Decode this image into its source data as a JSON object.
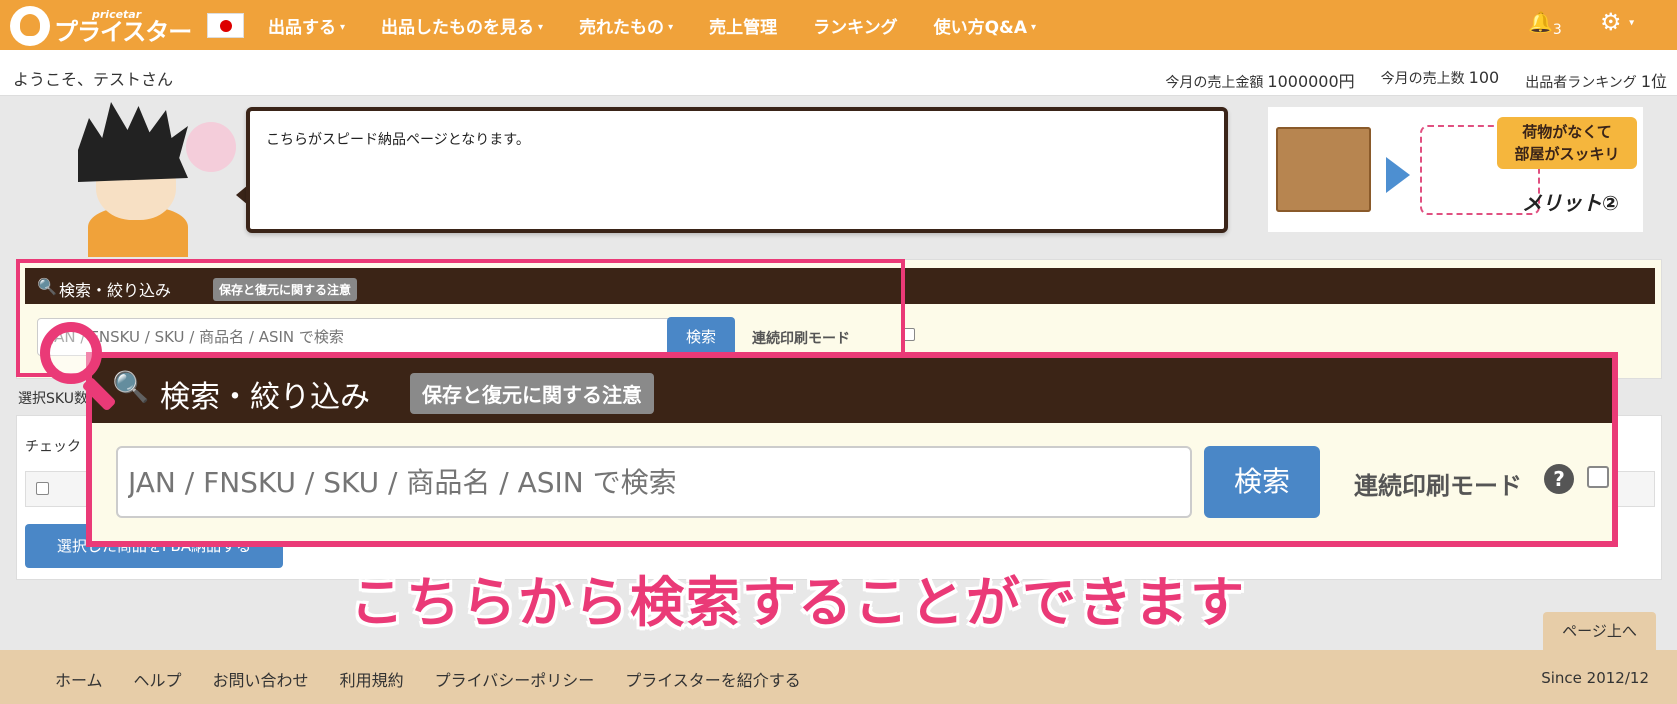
{
  "nav": {
    "logo_small": "pricetar",
    "logo_big": "プライスター",
    "items": [
      {
        "label": "出品する",
        "caret": "▾"
      },
      {
        "label": "出品したものを見る",
        "caret": "▾"
      },
      {
        "label": "売れたもの",
        "caret": "▾"
      },
      {
        "label": "売上管理",
        "caret": ""
      },
      {
        "label": "ランキング",
        "caret": ""
      },
      {
        "label": "使い方Q&A",
        "caret": "▾"
      }
    ],
    "bell_icon": "🔔",
    "bell_count": "3",
    "gear_icon": "⚙",
    "gear_caret": "▾"
  },
  "welcome": {
    "greeting": "ようこそ、テストさん",
    "sales_amount_label": "今月の売上金額",
    "sales_amount": "1000000円",
    "sales_count_label": "今月の売上数",
    "sales_count": "100",
    "ranking_label": "出品者ランキング",
    "ranking": "1位"
  },
  "bubble": {
    "text": "こちらがスピード納品ページとなります。"
  },
  "banner": {
    "tag_line1": "荷物がなくて",
    "tag_line2": "部屋がスッキリ",
    "merit": "メリット②"
  },
  "search_panel": {
    "search_icon": "🔍",
    "title": "検索・絞り込み",
    "badge": "保存と復元に関する注意",
    "placeholder": "JAN / FNSKU / SKU / 商品名 / ASIN で検索",
    "button": "検索",
    "mode_label": "連続印刷モード",
    "help_icon": "?"
  },
  "selection": {
    "sku_label": "選択SKU数",
    "check_label": "チェック",
    "fba_button": "選択した商品をFBA納品する"
  },
  "caption": "こちらから検索することができます",
  "page_top": "ページ上へ",
  "footer": {
    "links": [
      "ホーム",
      "ヘルプ",
      "お問い合わせ",
      "利用規約",
      "プライバシーポリシー",
      "プライスターを紹介する"
    ],
    "since": "Since 2012/12"
  }
}
